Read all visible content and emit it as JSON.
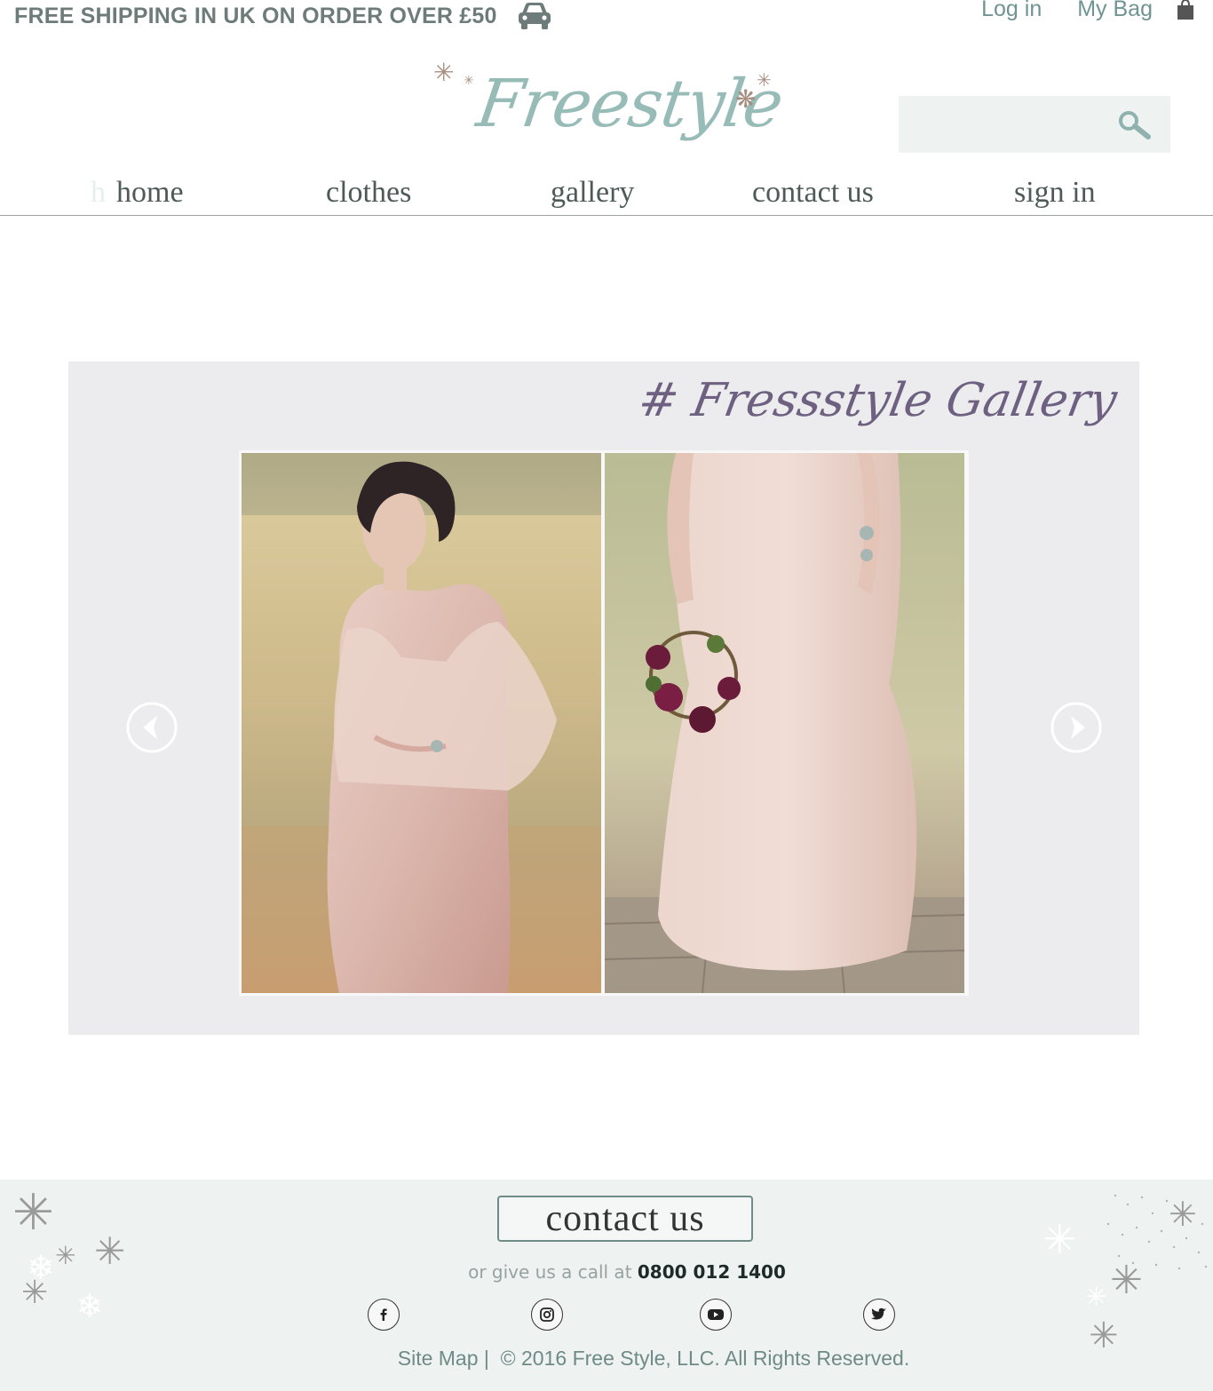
{
  "topbar": {
    "shipping_text": "FREE SHIPPING IN UK ON ORDER OVER £50",
    "shipping_icon": "car-icon",
    "login_label": "Log in",
    "bag_label": "My Bag",
    "bag_icon": "shopping-bag-icon"
  },
  "logo": {
    "text": "Freestyle"
  },
  "search": {
    "placeholder": "",
    "icon": "search-icon"
  },
  "nav": {
    "items": [
      {
        "label": "home"
      },
      {
        "label": "clothes"
      },
      {
        "label": "gallery"
      },
      {
        "label": "contact us"
      },
      {
        "label": "sign in"
      }
    ]
  },
  "gallery": {
    "title": "# Fressstyle Gallery",
    "prev_icon": "arrow-left-icon",
    "next_icon": "arrow-right-icon"
  },
  "footer": {
    "contact_label": "contact us",
    "call_prefix": "or give us a call at ",
    "phone": "0800 012 1400",
    "social_icons": [
      "facebook-icon",
      "instagram-icon",
      "youtube-icon",
      "twitter-icon"
    ],
    "sitemap_label": "Site Map",
    "separator": "|",
    "copyright": "© 2016 Free Style, LLC. All Rights Reserved."
  },
  "colors": {
    "accent": "#97bcb8",
    "text_gray": "#6d7c7a",
    "gallery_title": "#6e6080",
    "panel_bg": "#eef2f1",
    "gallery_bg": "#ececee"
  }
}
